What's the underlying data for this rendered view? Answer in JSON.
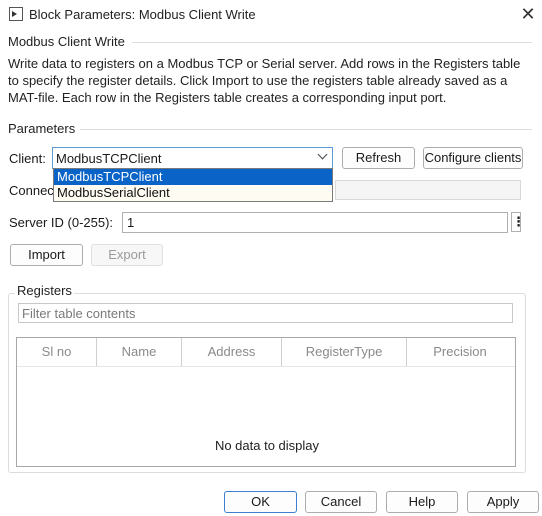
{
  "window": {
    "title": "Block Parameters: Modbus Client Write",
    "close_glyph": "✕"
  },
  "block": {
    "name": "Modbus Client Write",
    "description": "Write data to registers on a Modbus TCP or Serial server. Add rows in the Registers table to specify the register details. Click Import to use the registers table already saved as a MAT-file. Each row in the Registers table creates a corresponding input port."
  },
  "parameters": {
    "section_label": "Parameters",
    "client_label": "Client:",
    "client_value": "ModbusTCPClient",
    "client_options": [
      "ModbusTCPClient",
      "ModbusSerialClient"
    ],
    "refresh_label": "Refresh",
    "configure_label": "Configure clients",
    "connection_label": "Connec",
    "server_id_label": "Server ID (0-255):",
    "server_id_value": "1",
    "more_glyph": "⋮",
    "import_label": "Import",
    "export_label": "Export"
  },
  "registers": {
    "section_label": "Registers",
    "filter_placeholder": "Filter table contents",
    "columns": [
      "Sl no",
      "Name",
      "Address",
      "RegisterType",
      "Precision"
    ],
    "empty_text": "No data to display"
  },
  "footer": {
    "ok_label": "OK",
    "cancel_label": "Cancel",
    "help_label": "Help",
    "apply_label": "Apply"
  },
  "colors": {
    "selection": "#0a64c8",
    "focus_border": "#5b9bd5",
    "primary_border": "#3c7fd0"
  }
}
